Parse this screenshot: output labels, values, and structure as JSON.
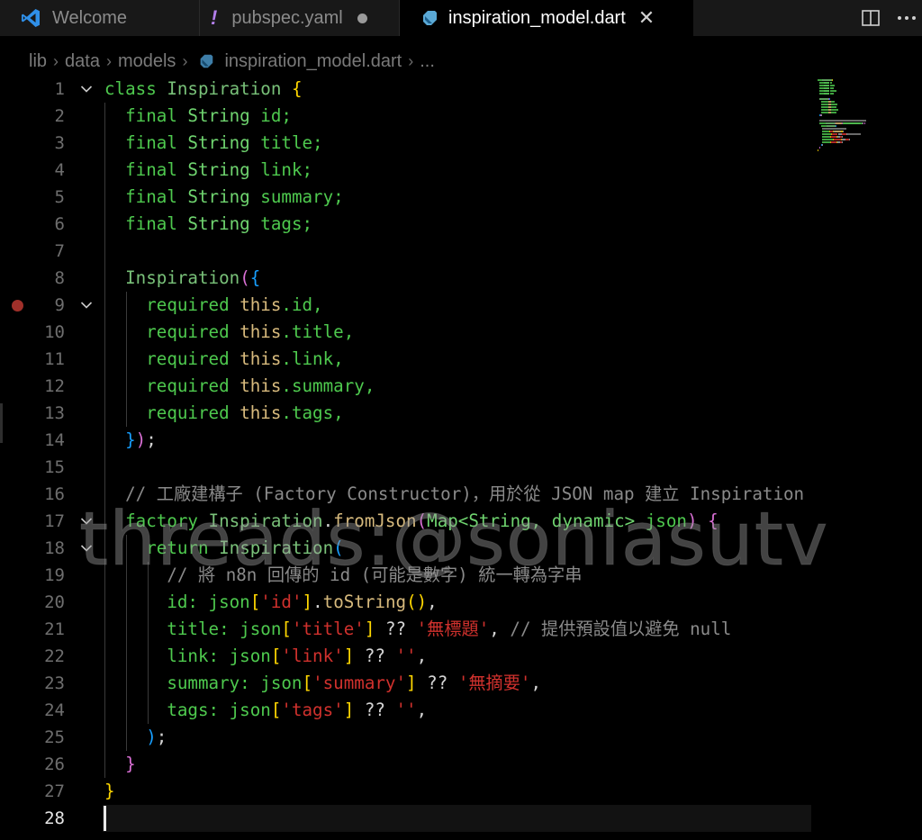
{
  "tabs": [
    {
      "label": "Welcome",
      "icon": "vscode-logo-icon",
      "state": "inactive"
    },
    {
      "label": "pubspec.yaml",
      "icon": "exclamation-icon",
      "state": "modified"
    },
    {
      "label": "inspiration_model.dart",
      "icon": "dart-icon",
      "state": "active"
    }
  ],
  "tab_close_glyph": "✕",
  "breadcrumb": {
    "segments": [
      "lib",
      "data",
      "models"
    ],
    "file": "inspiration_model.dart",
    "trailing": "..."
  },
  "editor": {
    "current_line": 28,
    "breakpoint_line": 9,
    "fold_lines": [
      1,
      9,
      17,
      18
    ],
    "lines": [
      {
        "n": "1",
        "tokens": [
          [
            "kw",
            "class "
          ],
          [
            "cls",
            "Inspiration "
          ],
          [
            "br1",
            "{"
          ]
        ]
      },
      {
        "n": "2",
        "tokens": [
          [
            "pl",
            "  "
          ],
          [
            "kw",
            "final "
          ],
          [
            "ty",
            "String "
          ],
          [
            "id",
            "id;"
          ]
        ]
      },
      {
        "n": "3",
        "tokens": [
          [
            "pl",
            "  "
          ],
          [
            "kw",
            "final "
          ],
          [
            "ty",
            "String "
          ],
          [
            "id",
            "title;"
          ]
        ]
      },
      {
        "n": "4",
        "tokens": [
          [
            "pl",
            "  "
          ],
          [
            "kw",
            "final "
          ],
          [
            "ty",
            "String "
          ],
          [
            "id",
            "link;"
          ]
        ]
      },
      {
        "n": "5",
        "tokens": [
          [
            "pl",
            "  "
          ],
          [
            "kw",
            "final "
          ],
          [
            "ty",
            "String "
          ],
          [
            "id",
            "summary;"
          ]
        ]
      },
      {
        "n": "6",
        "tokens": [
          [
            "pl",
            "  "
          ],
          [
            "kw",
            "final "
          ],
          [
            "ty",
            "String "
          ],
          [
            "id",
            "tags;"
          ]
        ]
      },
      {
        "n": "7",
        "tokens": []
      },
      {
        "n": "8",
        "tokens": [
          [
            "pl",
            "  "
          ],
          [
            "cls",
            "Inspiration"
          ],
          [
            "br2",
            "("
          ],
          [
            "br3",
            "{"
          ]
        ]
      },
      {
        "n": "9",
        "tokens": [
          [
            "pl",
            "    "
          ],
          [
            "kw",
            "required "
          ],
          [
            "th",
            "this"
          ],
          [
            "id",
            ".id,"
          ]
        ]
      },
      {
        "n": "10",
        "tokens": [
          [
            "pl",
            "    "
          ],
          [
            "kw",
            "required "
          ],
          [
            "th",
            "this"
          ],
          [
            "id",
            ".title,"
          ]
        ]
      },
      {
        "n": "11",
        "tokens": [
          [
            "pl",
            "    "
          ],
          [
            "kw",
            "required "
          ],
          [
            "th",
            "this"
          ],
          [
            "id",
            ".link,"
          ]
        ]
      },
      {
        "n": "12",
        "tokens": [
          [
            "pl",
            "    "
          ],
          [
            "kw",
            "required "
          ],
          [
            "th",
            "this"
          ],
          [
            "id",
            ".summary,"
          ]
        ]
      },
      {
        "n": "13",
        "tokens": [
          [
            "pl",
            "    "
          ],
          [
            "kw",
            "required "
          ],
          [
            "th",
            "this"
          ],
          [
            "id",
            ".tags,"
          ]
        ]
      },
      {
        "n": "14",
        "tokens": [
          [
            "pl",
            "  "
          ],
          [
            "br3",
            "}"
          ],
          [
            "br2",
            ")"
          ],
          [
            "pl",
            ";"
          ]
        ]
      },
      {
        "n": "15",
        "tokens": []
      },
      {
        "n": "16",
        "tokens": [
          [
            "pl",
            "  "
          ],
          [
            "cm",
            "// 工廠建構子 (Factory Constructor)，用於從 JSON map 建立 Inspiration"
          ]
        ]
      },
      {
        "n": "17",
        "tokens": [
          [
            "pl",
            "  "
          ],
          [
            "kw",
            "factory "
          ],
          [
            "cls",
            "Inspiration"
          ],
          [
            "pl",
            "."
          ],
          [
            "th",
            "fromJson"
          ],
          [
            "br2",
            "("
          ],
          [
            "ty",
            "Map<String, dynamic> "
          ],
          [
            "id",
            "json"
          ],
          [
            "br2",
            ")"
          ],
          [
            "pl",
            " "
          ],
          [
            "br2",
            "{"
          ]
        ]
      },
      {
        "n": "18",
        "tokens": [
          [
            "pl",
            "    "
          ],
          [
            "kw",
            "return "
          ],
          [
            "cls",
            "Inspiration"
          ],
          [
            "br3",
            "("
          ]
        ]
      },
      {
        "n": "19",
        "tokens": [
          [
            "pl",
            "      "
          ],
          [
            "cm",
            "// 將 n8n 回傳的 id (可能是數字) 統一轉為字串"
          ]
        ]
      },
      {
        "n": "20",
        "tokens": [
          [
            "pl",
            "      "
          ],
          [
            "id",
            "id: json"
          ],
          [
            "br1",
            "["
          ],
          [
            "str",
            "'id'"
          ],
          [
            "br1",
            "]"
          ],
          [
            "pl",
            "."
          ],
          [
            "th",
            "toString"
          ],
          [
            "br1",
            "()"
          ],
          [
            "pl",
            ","
          ]
        ]
      },
      {
        "n": "21",
        "tokens": [
          [
            "pl",
            "      "
          ],
          [
            "id",
            "title: json"
          ],
          [
            "br1",
            "["
          ],
          [
            "str",
            "'title'"
          ],
          [
            "br1",
            "]"
          ],
          [
            "pl",
            " ?? "
          ],
          [
            "str",
            "'無標題'"
          ],
          [
            "pl",
            ", "
          ],
          [
            "cm",
            "// 提供預設值以避免 null"
          ]
        ]
      },
      {
        "n": "22",
        "tokens": [
          [
            "pl",
            "      "
          ],
          [
            "id",
            "link: json"
          ],
          [
            "br1",
            "["
          ],
          [
            "str",
            "'link'"
          ],
          [
            "br1",
            "]"
          ],
          [
            "pl",
            " ?? "
          ],
          [
            "str",
            "''"
          ],
          [
            "pl",
            ","
          ]
        ]
      },
      {
        "n": "23",
        "tokens": [
          [
            "pl",
            "      "
          ],
          [
            "id",
            "summary: json"
          ],
          [
            "br1",
            "["
          ],
          [
            "str",
            "'summary'"
          ],
          [
            "br1",
            "]"
          ],
          [
            "pl",
            " ?? "
          ],
          [
            "str",
            "'無摘要'"
          ],
          [
            "pl",
            ","
          ]
        ]
      },
      {
        "n": "24",
        "tokens": [
          [
            "pl",
            "      "
          ],
          [
            "id",
            "tags: json"
          ],
          [
            "br1",
            "["
          ],
          [
            "str",
            "'tags'"
          ],
          [
            "br1",
            "]"
          ],
          [
            "pl",
            " ?? "
          ],
          [
            "str",
            "''"
          ],
          [
            "pl",
            ","
          ]
        ]
      },
      {
        "n": "25",
        "tokens": [
          [
            "pl",
            "    "
          ],
          [
            "br3",
            ")"
          ],
          [
            "pl",
            ";"
          ]
        ]
      },
      {
        "n": "26",
        "tokens": [
          [
            "pl",
            "  "
          ],
          [
            "br2",
            "}"
          ]
        ]
      },
      {
        "n": "27",
        "tokens": [
          [
            "br1",
            "}"
          ]
        ]
      },
      {
        "n": "28",
        "tokens": []
      }
    ]
  },
  "watermark": "threads:@soniasutv",
  "colors": {
    "background": "#000000",
    "tabbar": "#181818",
    "keyword": "#4ec94e",
    "string": "#d0312d",
    "comment": "#8a8a8a",
    "bracket_gold": "#ffd700",
    "bracket_magenta": "#da70d6",
    "bracket_blue": "#179fff",
    "breakpoint": "#a0302a"
  }
}
